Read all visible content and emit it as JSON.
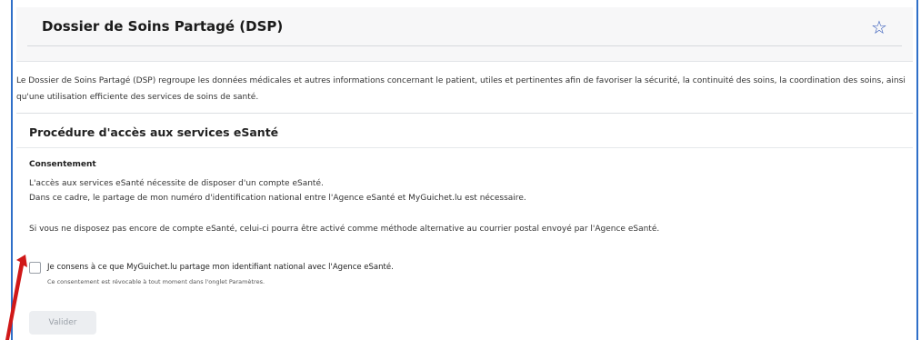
{
  "header": {
    "title": "Dossier de Soins Partagé (DSP)",
    "favorite_icon": "star-icon"
  },
  "intro": {
    "text": "Le Dossier de Soins Partagé (DSP) regroupe les données médicales et autres informations concernant le patient, utiles et pertinentes afin de favoriser la sécurité, la continuité des soins, la coordination des soins, ainsi qu'une utilisation efficiente des services de soins de santé."
  },
  "procedure": {
    "title": "Procédure d'accès aux services eSanté",
    "consent_heading": "Consentement",
    "line1": "L'accès aux services eSanté nécessite de disposer d'un compte eSanté.",
    "line2": "Dans ce cadre, le partage de mon numéro d'identification national entre l'Agence eSanté et MyGuichet.lu est nécessaire.",
    "line3": "Si vous ne disposez pas encore de compte eSanté, celui-ci pourra être activé  comme méthode alternative au courrier postal envoyé par l'Agence eSanté."
  },
  "consent": {
    "checked": false,
    "label": "Je consens à ce que MyGuichet.lu partage mon identifiant national avec l'Agence eSanté.",
    "sublabel": "Ce consentement est révocable à tout moment dans l'onglet Paramètres."
  },
  "actions": {
    "validate_label": "Valider"
  },
  "colors": {
    "accent": "#2f56b8",
    "arrow": "#d01818"
  }
}
